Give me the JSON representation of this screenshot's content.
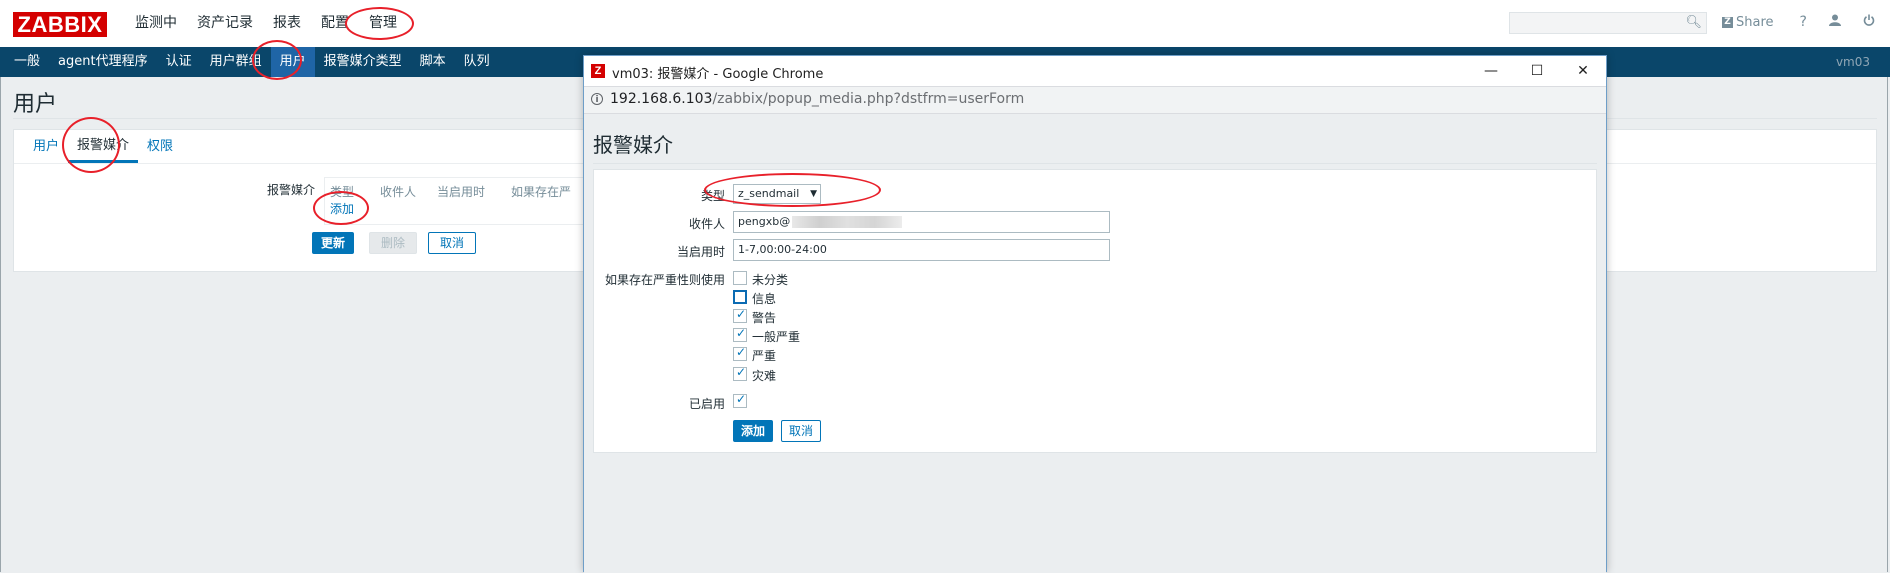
{
  "app": {
    "logo": "ZABBIX"
  },
  "topnav": [
    "监测中",
    "资产记录",
    "报表",
    "配置",
    "管理"
  ],
  "header": {
    "search_placeholder": "",
    "share_label": "Share",
    "help_icon": "?",
    "user_icon": "user-icon",
    "logout_icon": "power-icon"
  },
  "subnav": {
    "items": [
      "一般",
      "agent代理程序",
      "认证",
      "用户群组",
      "用户",
      "报警媒介类型",
      "脚本",
      "队列"
    ],
    "active": "用户",
    "host": "vm03"
  },
  "page": {
    "title": "用户",
    "tabs": [
      "用户",
      "报警媒介",
      "权限"
    ],
    "active_tab": "报警媒介",
    "media_label": "报警媒介",
    "media_table_headers": [
      "类型",
      "收件人",
      "当启用时",
      "如果存在严"
    ],
    "add_link": "添加",
    "buttons": {
      "update": "更新",
      "delete": "删除",
      "cancel": "取消"
    }
  },
  "popup": {
    "window_title": "vm03: 报警媒介 - Google Chrome",
    "url_host": "192.168.6.103",
    "url_path": "/zabbix/popup_media.php?dstfrm=userForm",
    "heading": "报警媒介",
    "form": {
      "type_label": "类型",
      "type_value": "z_sendmail",
      "sendto_label": "收件人",
      "sendto_value": "pengxb@",
      "when_active_label": "当启用时",
      "when_active_value": "1-7,00:00-24:00",
      "severity_label": "如果存在严重性则使用",
      "severities": [
        {
          "label": "未分类",
          "checked": false
        },
        {
          "label": "信息",
          "checked": false
        },
        {
          "label": "警告",
          "checked": true
        },
        {
          "label": "一般严重",
          "checked": true
        },
        {
          "label": "严重",
          "checked": true
        },
        {
          "label": "灾难",
          "checked": true
        }
      ],
      "enabled_label": "已启用",
      "enabled": true,
      "add_button": "添加",
      "cancel_button": "取消"
    }
  },
  "colors": {
    "brand_red": "#d40000",
    "subnav_bg": "#0a466a",
    "accent_blue": "#0275b8",
    "annotation_red": "#e8202a"
  }
}
